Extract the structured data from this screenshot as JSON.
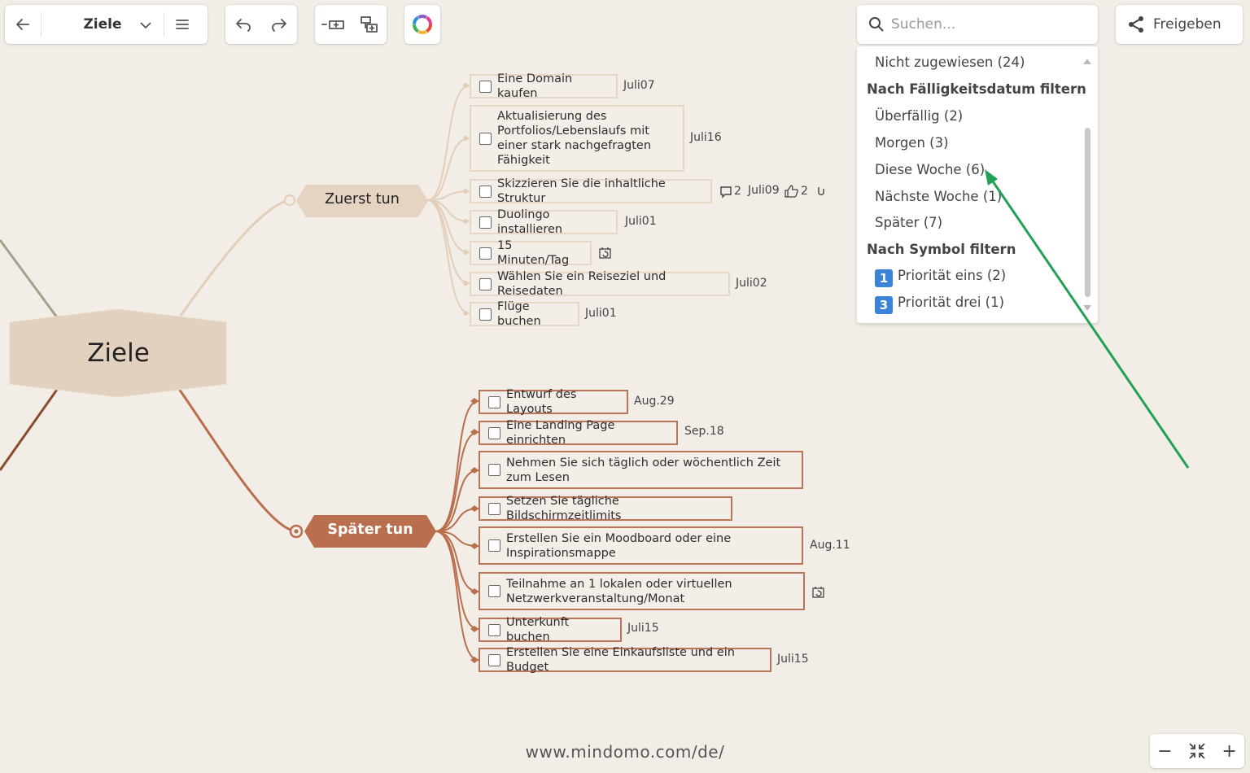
{
  "toolbar": {
    "title": "Ziele"
  },
  "search": {
    "placeholder": "Suchen..."
  },
  "share": {
    "label": "Freigeben"
  },
  "filter_dropdown": {
    "unassigned": "Nicht zugewiesen (24)",
    "due_header": "Nach Fälligkeitsdatum filtern",
    "overdue": "Überfällig (2)",
    "tomorrow": "Morgen (3)",
    "this_week": "Diese Woche (6)",
    "next_week": "Nächste Woche (1)",
    "later": "Später (7)",
    "symbol_header": "Nach Symbol filtern",
    "prio_one_num": "1",
    "prio_one": "Priorität eins (2)",
    "prio_three_num": "3",
    "prio_three": "Priorität drei (1)"
  },
  "map": {
    "root": "Ziele",
    "branch1": {
      "label": "Zuerst tun",
      "tasks": [
        {
          "text": "Eine Domain kaufen",
          "date": "Juli07"
        },
        {
          "text": "Aktualisierung des Portfolios/Lebenslaufs mit einer stark nachgefragten Fähigkeit",
          "date": "Juli16"
        },
        {
          "text": "Skizzieren Sie die inhaltliche Struktur",
          "comments": "2",
          "date": "Juli09",
          "likes": "2"
        },
        {
          "text": "Duolingo installieren",
          "date": "Juli01"
        },
        {
          "text": "15 Minuten/Tag"
        },
        {
          "text": "Wählen Sie ein Reiseziel und Reisedaten",
          "date": "Juli02"
        },
        {
          "text": "Flüge buchen",
          "date": "Juli01"
        }
      ]
    },
    "branch2": {
      "label": "Später tun",
      "tasks": [
        {
          "text": "Entwurf des Layouts",
          "date": "Aug.29"
        },
        {
          "text": "Eine Landing Page einrichten",
          "date": "Sep.18"
        },
        {
          "text": "Nehmen Sie sich täglich oder wöchentlich Zeit zum Lesen"
        },
        {
          "text": "Setzen Sie tägliche Bildschirmzeitlimits"
        },
        {
          "text": "Erstellen Sie ein Moodboard oder eine Inspirationsmappe",
          "date": "Aug.11"
        },
        {
          "text": "Teilnahme an 1 lokalen oder virtuellen Netzwerkveranstaltung/Monat"
        },
        {
          "text": "Unterkunft buchen",
          "date": "Juli15"
        },
        {
          "text": "Erstellen Sie eine Einkaufsliste und ein Budget",
          "date": "Juli15"
        }
      ]
    }
  },
  "footer": {
    "url": "www.mindomo.com/de/"
  },
  "zoom": {
    "minus": "−",
    "plus": "+"
  },
  "colors": {
    "background": "#f2ede6",
    "branch1": "#e3cfb9",
    "branch2": "#b96e4d",
    "arrow": "#22a055",
    "priority": "#3b82d9"
  }
}
